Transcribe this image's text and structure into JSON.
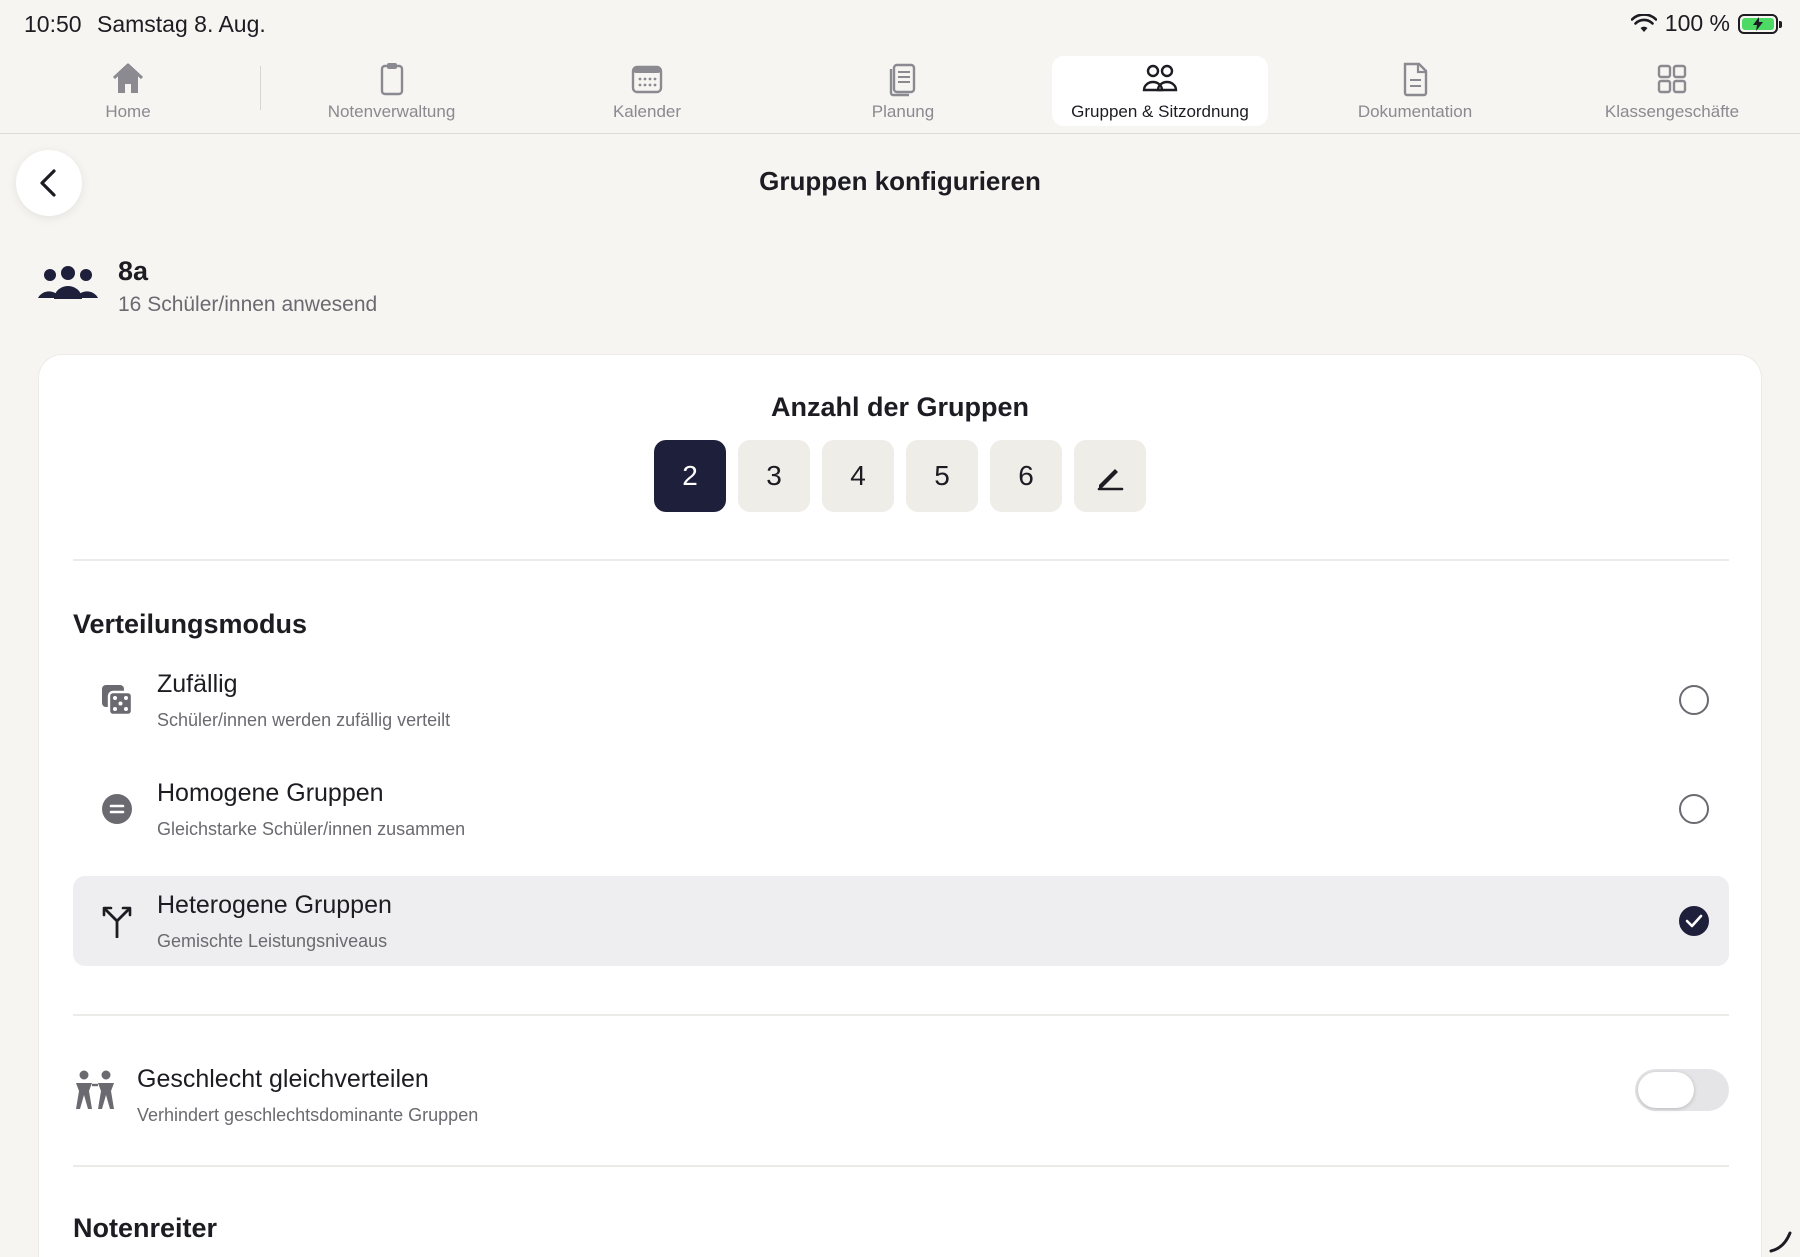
{
  "status_bar": {
    "time": "10:50",
    "date": "Samstag 8. Aug.",
    "battery": "100 %"
  },
  "tabs": [
    {
      "label": "Home",
      "icon": "home-icon"
    },
    {
      "label": "Notenverwaltung",
      "icon": "clipboard-icon"
    },
    {
      "label": "Kalender",
      "icon": "calendar-icon"
    },
    {
      "label": "Planung",
      "icon": "document-stack-icon"
    },
    {
      "label": "Gruppen & Sitzordnung",
      "icon": "people-icon",
      "active": true
    },
    {
      "label": "Dokumentation",
      "icon": "document-icon"
    },
    {
      "label": "Klassengeschäfte",
      "icon": "grid-icon"
    }
  ],
  "page": {
    "title": "Gruppen konfigurieren"
  },
  "class_info": {
    "name": "8a",
    "subtitle": "16 Schüler/innen anwesend"
  },
  "group_count": {
    "title": "Anzahl der Gruppen",
    "options": [
      "2",
      "3",
      "4",
      "5",
      "6"
    ],
    "selected": "2"
  },
  "distribution": {
    "title": "Verteilungsmodus",
    "modes": [
      {
        "title": "Zufällig",
        "description": "Schüler/innen werden zufällig verteilt",
        "icon": "dice-icon",
        "selected": false
      },
      {
        "title": "Homogene Gruppen",
        "description": "Gleichstarke Schüler/innen zusammen",
        "icon": "equal-circle-icon",
        "selected": false
      },
      {
        "title": "Heterogene Gruppen",
        "description": "Gemischte Leistungsniveaus",
        "icon": "split-arrow-icon",
        "selected": true
      }
    ]
  },
  "gender": {
    "title": "Geschlecht gleichverteilen",
    "description": "Verhindert geschlechtsdominante Gruppen",
    "enabled": false
  },
  "grades_tab": {
    "title": "Notenreiter"
  },
  "colors": {
    "accent": "#1e1f3b",
    "background": "#f6f5f2",
    "card": "#ffffff",
    "battery": "#4cd964"
  }
}
